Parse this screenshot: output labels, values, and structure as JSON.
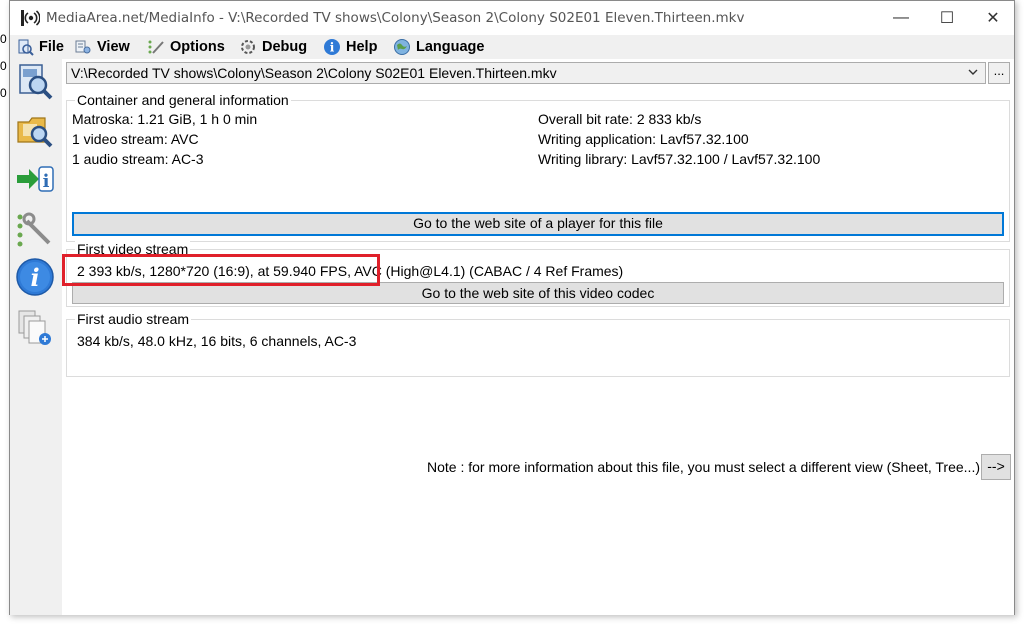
{
  "edge": {
    "digits": [
      "0",
      "0",
      "0"
    ]
  },
  "window": {
    "title": "MediaArea.net/MediaInfo - V:\\Recorded TV shows\\Colony\\Season 2\\Colony S02E01 Eleven.Thirteen.mkv",
    "controls": {
      "minimize": "—",
      "maximize": "☐",
      "close": "✕"
    }
  },
  "menu": {
    "items": [
      {
        "label": "File",
        "icon": "file-icon"
      },
      {
        "label": "View",
        "icon": "view-icon"
      },
      {
        "label": "Options",
        "icon": "options-icon"
      },
      {
        "label": "Debug",
        "icon": "debug-icon"
      },
      {
        "label": "Help",
        "icon": "help-icon"
      },
      {
        "label": "Language",
        "icon": "language-icon"
      }
    ]
  },
  "sidebar": {
    "buttons": [
      "open-file-icon",
      "open-folder-icon",
      "export-icon",
      "preferences-icon",
      "about-icon",
      "knowledge-base-icon"
    ]
  },
  "file": {
    "path": "V:\\Recorded TV shows\\Colony\\Season 2\\Colony S02E01 Eleven.Thirteen.mkv",
    "browse_label": "..."
  },
  "general": {
    "legend": "Container and general information",
    "left": [
      "Matroska: 1.21 GiB, 1 h 0 min",
      "1 video stream: AVC",
      "1 audio stream: AC-3"
    ],
    "right": [
      "Overall bit rate: 2 833 kb/s",
      "Writing application: Lavf57.32.100",
      "Writing library: Lavf57.32.100 / Lavf57.32.100"
    ],
    "button": "Go to the web site of a player for this file"
  },
  "video": {
    "legend": "First video stream",
    "info": "2 393 kb/s, 1280*720 (16:9), at 59.940 FPS, AVC (High@L4.1) (CABAC / 4 Ref Frames)",
    "button": "Go to the web site of this video codec"
  },
  "audio": {
    "legend": "First audio stream",
    "info": "384 kb/s, 48.0 kHz, 16 bits, 6 channels, AC-3"
  },
  "note": {
    "text": "Note : for more information about this file, you must select a different view (Sheet, Tree...)",
    "button": "-->"
  },
  "colors": {
    "highlight": "#e0202a",
    "focus": "#0078d7"
  }
}
